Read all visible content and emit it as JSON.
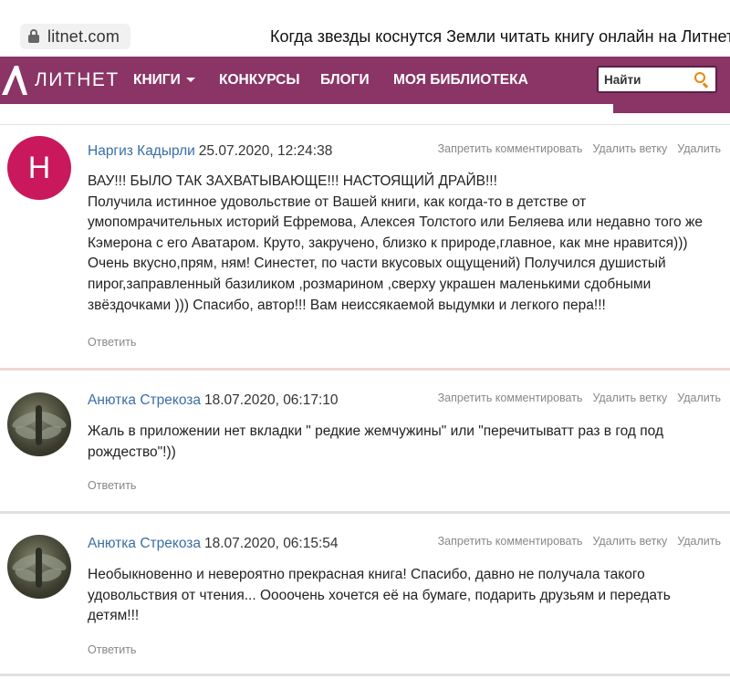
{
  "browser": {
    "url": "litnet.com",
    "title": "Когда звезды коснутся Земли читать книгу онлайн на Литнет"
  },
  "nav": {
    "logo": "ЛИТНЕТ",
    "books": "КНИГИ",
    "contests": "КОНКУРСЫ",
    "blogs": "БЛОГИ",
    "library": "МОЯ БИБЛИОТЕКА",
    "search_placeholder": "Найти"
  },
  "colors": {
    "brand": "#8a3566",
    "avatar_letter_bg": "#c9185c",
    "author_link": "#3a6ea5",
    "search_icon": "#e8890c"
  },
  "comment_actions": {
    "ban": "Запретить комментировать",
    "delete_branch": "Удалить ветку",
    "delete": "Удалить",
    "reply": "Ответить"
  },
  "comments": [
    {
      "author": "Наргиз Кадырли",
      "datetime": "25.07.2020, 12:24:38",
      "avatar_letter": "Н",
      "text": "ВАУ!!! БЫЛО ТАК ЗАХВАТЫВАЮЩЕ!!! НАСТОЯЩИЙ ДРАЙВ!!!\nПолучила истинное удовольствие от Вашей книги, как когда-то в детстве от умопомрачительных историй Ефремова, Алексея Толстого или Беляева или недавно того же Кэмерона с его Аватаром. Круто, закручено, близко к природе,главное, как мне нравится))) Очень вкусно,прям, ням! Синестет, по части вкусовых ощущений) Получился душистый пирог,заправленный базиликом ,розмарином ,сверху украшен маленькими сдобными звёздочками ))) Спасибо, автор!!! Вам неиссякаемой выдумки и легкого пера!!!"
    },
    {
      "author": "Анютка Стрекоза",
      "datetime": "18.07.2020, 06:17:10",
      "text": "Жаль в приложении нет вкладки \" редкие жемчужины\" или \"перечитыватт раз в год под рождество\"!))"
    },
    {
      "author": "Анютка Стрекоза",
      "datetime": "18.07.2020, 06:15:54",
      "text": "Необыкновенно и невероятно прекрасная книга! Спасибо, давно не получала такого удовольствия от чтения... Оооочень хочется её на бумаге, подарить друзьям и передать детям!!!"
    }
  ]
}
